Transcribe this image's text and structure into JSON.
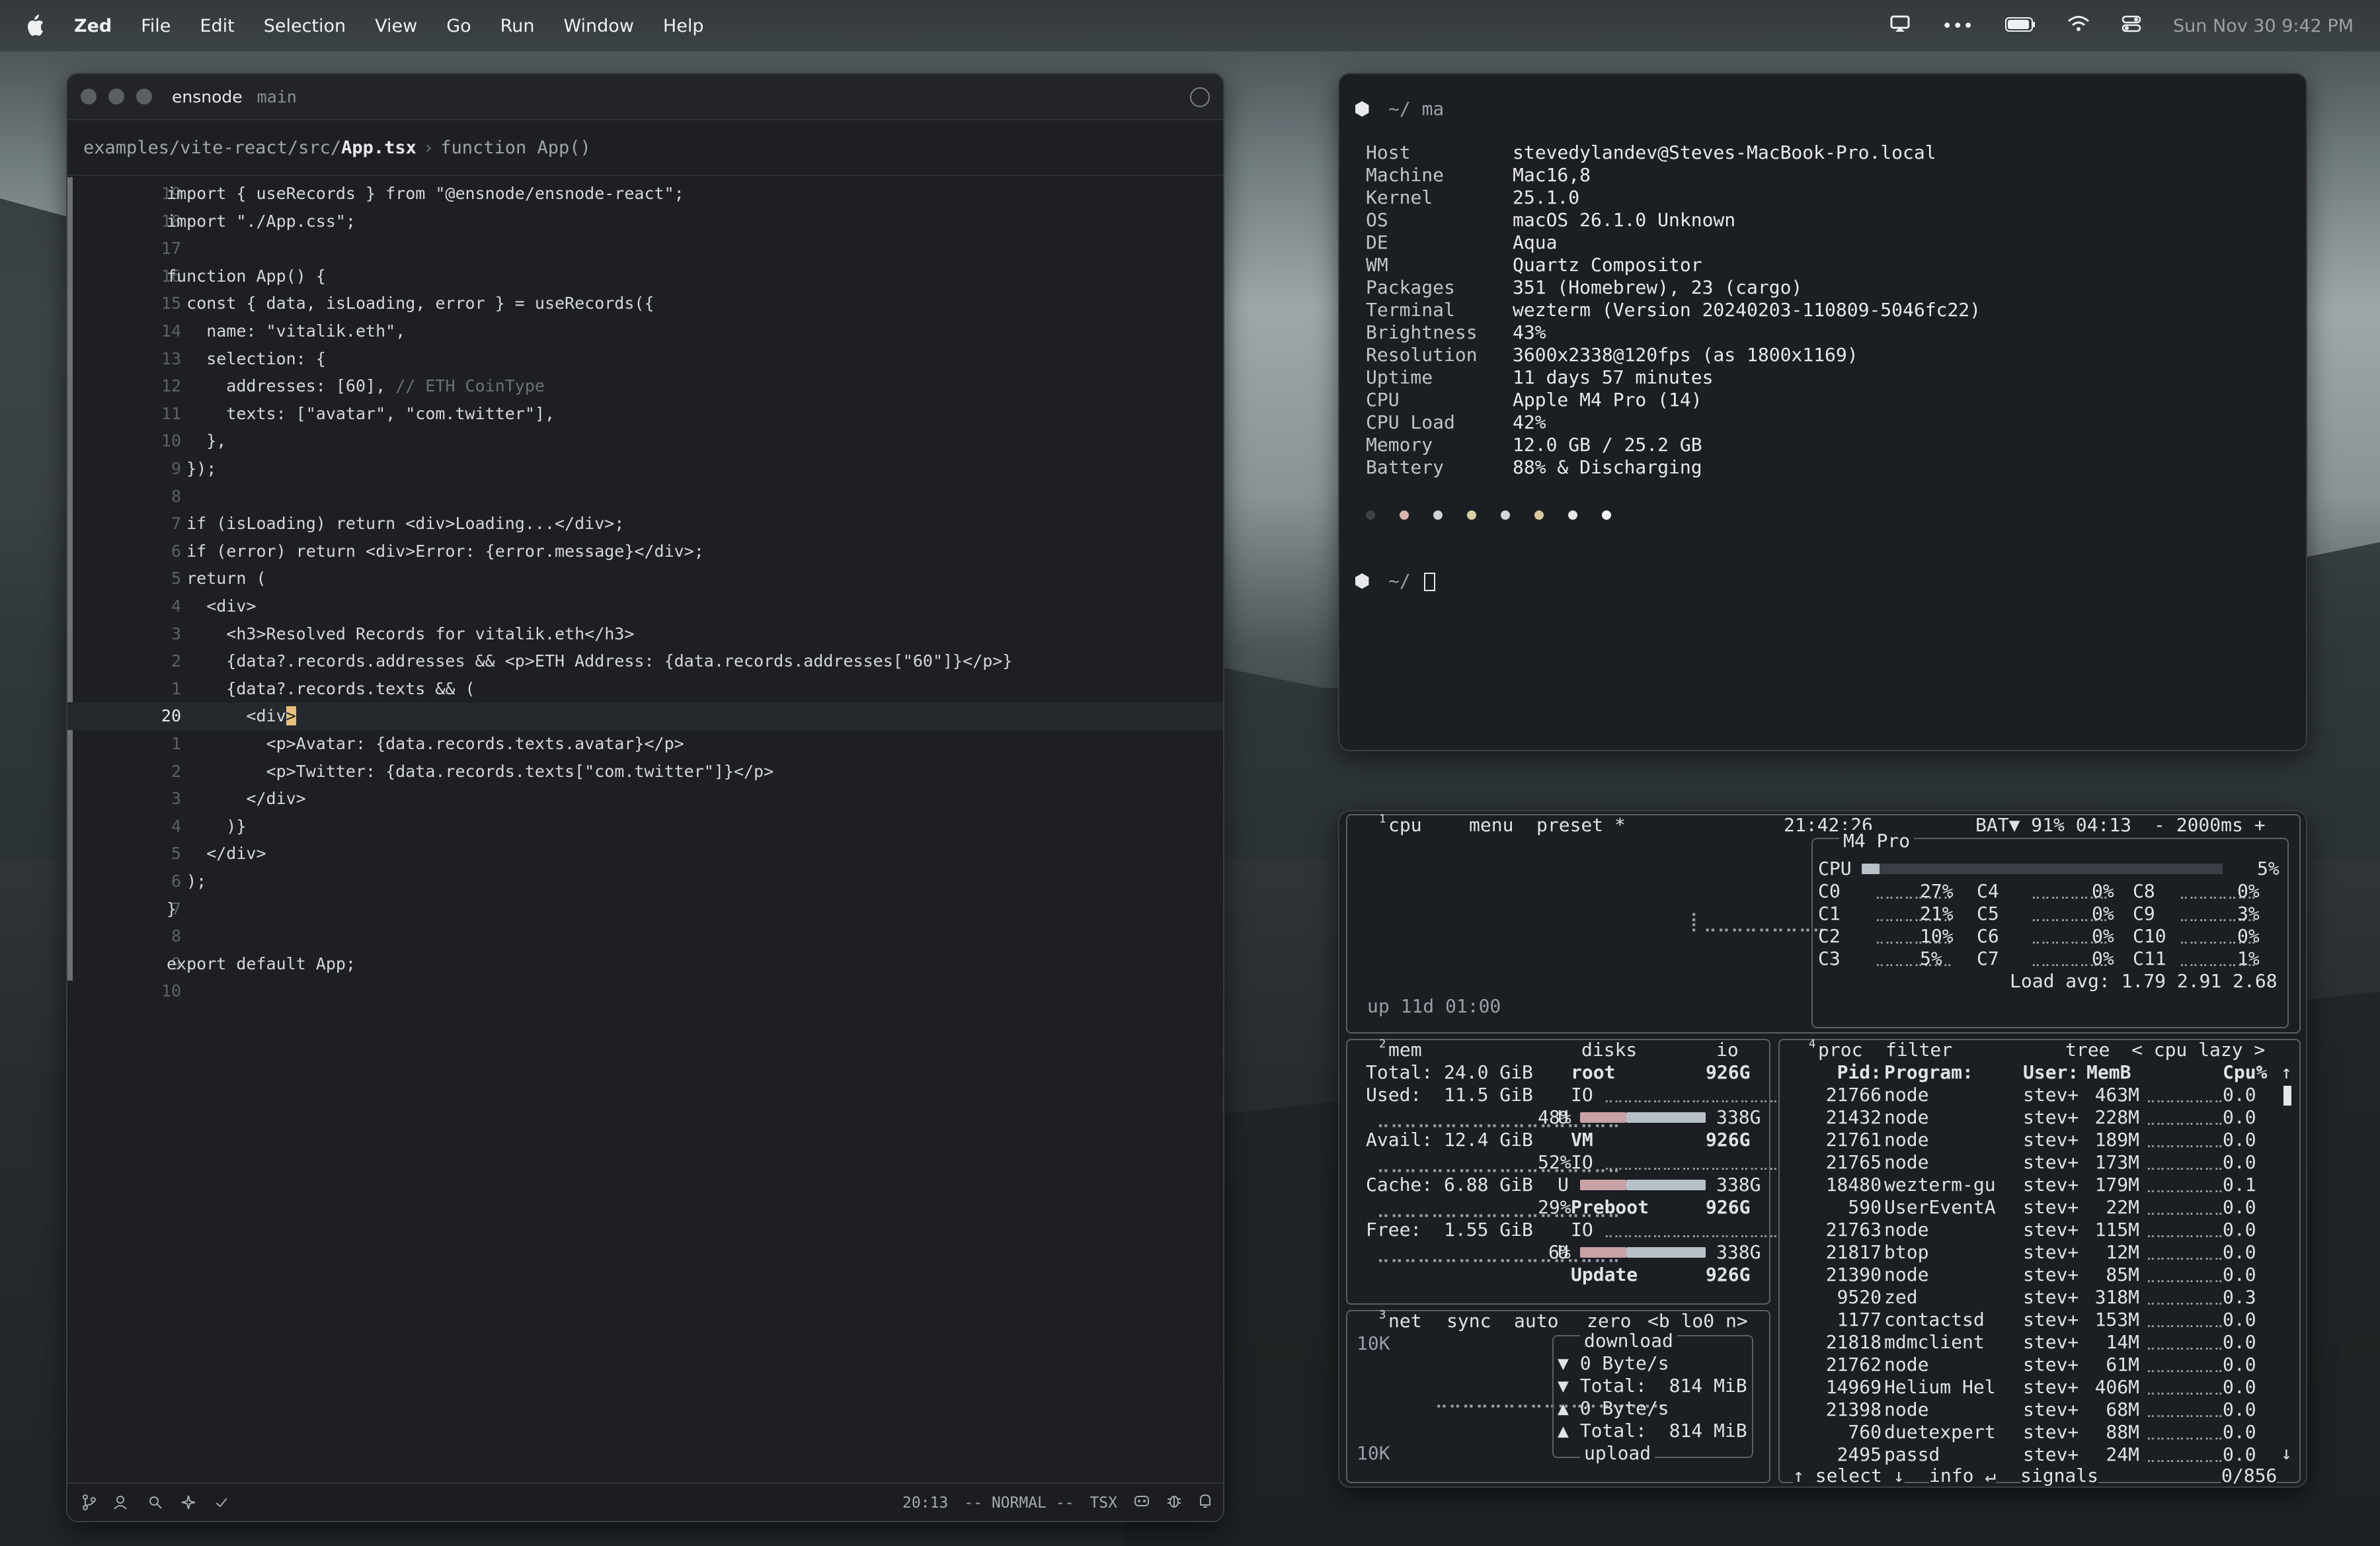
{
  "menubar": {
    "app": "Zed",
    "items": [
      "File",
      "Edit",
      "Selection",
      "View",
      "Go",
      "Run",
      "Window",
      "Help"
    ],
    "clock": "Sun Nov 30  9:42 PM"
  },
  "zed": {
    "project": "ensnode",
    "branch": "main",
    "breadcrumb": {
      "path": "examples/vite-react/src/",
      "file": "App.tsx",
      "separator": "›",
      "symbol": "function App()"
    },
    "lines": [
      {
        "n": "19",
        "t": "import { useRecords } from \"@ensnode/ensnode-react\";"
      },
      {
        "n": "18",
        "t": "import \"./App.css\";"
      },
      {
        "n": "17",
        "t": ""
      },
      {
        "n": "16",
        "t": "function App() {"
      },
      {
        "n": "15",
        "t": "  const { data, isLoading, error } = useRecords({"
      },
      {
        "n": "14",
        "t": "    name: \"vitalik.eth\","
      },
      {
        "n": "13",
        "t": "    selection: {"
      },
      {
        "n": "12",
        "t": "      addresses: [60], ",
        "c": "// ETH CoinType"
      },
      {
        "n": "11",
        "t": "      texts: [\"avatar\", \"com.twitter\"],"
      },
      {
        "n": "10",
        "t": "    },"
      },
      {
        "n": "9",
        "t": "  });"
      },
      {
        "n": "8",
        "t": ""
      },
      {
        "n": "7",
        "t": "  if (isLoading) return <div>Loading...</div>;"
      },
      {
        "n": "6",
        "t": "  if (error) return <div>Error: {error.message}</div>;"
      },
      {
        "n": "5",
        "t": "  return ("
      },
      {
        "n": "4",
        "t": "    <div>"
      },
      {
        "n": "3",
        "t": "      <h3>Resolved Records for vitalik.eth</h3>"
      },
      {
        "n": "2",
        "t": "      {data?.records.addresses && <p>ETH Address: {data.records.addresses[\"60\"]}</p>}"
      },
      {
        "n": "1",
        "t": "      {data?.records.texts && ("
      },
      {
        "n": "20",
        "t": "        <div",
        "cur": ">"
      },
      {
        "n": "1",
        "t": "          <p>Avatar: {data.records.texts.avatar}</p>"
      },
      {
        "n": "2",
        "t": "          <p>Twitter: {data.records.texts[\"com.twitter\"]}</p>"
      },
      {
        "n": "3",
        "t": "        </div>"
      },
      {
        "n": "4",
        "t": "      )}"
      },
      {
        "n": "5",
        "t": "    </div>"
      },
      {
        "n": "6",
        "t": "  );"
      },
      {
        "n": "7",
        "t": "}"
      },
      {
        "n": "8",
        "t": ""
      },
      {
        "n": "9",
        "t": "export default App;"
      },
      {
        "n": "10",
        "t": ""
      }
    ],
    "status": {
      "position": "20:13",
      "mode": "-- NORMAL --",
      "lang": "TSX"
    }
  },
  "terminal": {
    "prompt1": "~/ ma",
    "info": [
      [
        "Host",
        "stevedylandev@Steves-MacBook-Pro.local"
      ],
      [
        "Machine",
        "Mac16,8"
      ],
      [
        "Kernel",
        "25.1.0"
      ],
      [
        "OS",
        "macOS 26.1.0 Unknown"
      ],
      [
        "DE",
        "Aqua"
      ],
      [
        "WM",
        "Quartz Compositor"
      ],
      [
        "Packages",
        "351 (Homebrew), 23 (cargo)"
      ],
      [
        "Terminal",
        "wezterm (Version 20240203-110809-5046fc22)"
      ],
      [
        "Brightness",
        "43%"
      ],
      [
        "Resolution",
        "3600x2338@120fps (as 1800x1169)"
      ],
      [
        "Uptime",
        "11 days 57 minutes"
      ],
      [
        "CPU",
        "Apple M4 Pro (14)"
      ],
      [
        "CPU Load",
        "42%"
      ],
      [
        "Memory",
        "12.0 GB / 25.2 GB"
      ],
      [
        "Battery",
        "88% & Discharging"
      ]
    ],
    "dot_colors": [
      "#3d4247",
      "#d8b3b0",
      "#cfd3d6",
      "#d9cfa0",
      "#d4d6d8",
      "#d8c79a",
      "#e6e6e6",
      "#f2f2f2"
    ],
    "prompt2": "~/"
  },
  "btop": {
    "cpu_header": {
      "sup": "1",
      "title": "cpu",
      "menu": "menu",
      "preset": "preset *",
      "time": "21:42:26",
      "bat": "BAT▼ 91% 04:13",
      "rate": "- 2000ms +"
    },
    "cpu_box": {
      "title": "M4 Pro",
      "total_label": "CPU",
      "total": "5%",
      "total_pct": 5,
      "cores": [
        [
          "C0",
          "27%",
          "C4",
          "0%",
          "C8",
          "0%"
        ],
        [
          "C1",
          "21%",
          "C5",
          "0%",
          "C9",
          "3%"
        ],
        [
          "C2",
          "10%",
          "C6",
          "0%",
          "C10",
          "0%"
        ],
        [
          "C3",
          "5%",
          "C7",
          "0%",
          "C11",
          "1%"
        ]
      ],
      "load": "Load avg: 1.79 2.91 2.68"
    },
    "uptime": "up 11d 01:00",
    "mem": {
      "sup": "2",
      "title": "mem",
      "total": "Total: 24.0 GiB",
      "used": "Used:  11.5 GiB",
      "used_pct": "48%",
      "avail": "Avail: 12.4 GiB",
      "avail_pct": "52%",
      "cache": "Cache: 6.88 GiB",
      "cache_pct": "29%",
      "free": "Free:  1.55 GiB",
      "free_pct": "6%"
    },
    "disks": {
      "title": "disks",
      "io": "io",
      "items": [
        [
          "root",
          "926G",
          "IO",
          "U",
          "338G"
        ],
        [
          "VM",
          "926G",
          "IO",
          "U",
          "338G"
        ],
        [
          "Preboot",
          "926G",
          "IO",
          "U",
          "338G"
        ],
        [
          "Update",
          "926G"
        ]
      ]
    },
    "net": {
      "sup": "3",
      "title": "net",
      "sync": "sync",
      "auto": "auto",
      "zero": "zero",
      "iface": "<b lo0 n>",
      "scale_top": "10K",
      "scale_bot": "10K",
      "download": "download",
      "dl_rate": "▼ 0 Byte/s",
      "dl_total": "▼ Total:  814 MiB",
      "ul_rate": "▲ 0 Byte/s",
      "ul_total": "▲ Total:  814 MiB",
      "upload": "upload"
    },
    "proc": {
      "sup": "4",
      "title": "proc",
      "filter": "filter",
      "tree": "tree",
      "sort": "< cpu lazy >",
      "headers": [
        "Pid:",
        "Program:",
        "User:",
        "MemB",
        "Cpu%"
      ],
      "rows": [
        [
          "21766",
          "node",
          "stev+",
          "463M",
          "0.0"
        ],
        [
          "21432",
          "node",
          "stev+",
          "228M",
          "0.0"
        ],
        [
          "21761",
          "node",
          "stev+",
          "189M",
          "0.0"
        ],
        [
          "21765",
          "node",
          "stev+",
          "173M",
          "0.0"
        ],
        [
          "18480",
          "wezterm-gu",
          "stev+",
          "179M",
          "0.1"
        ],
        [
          "590",
          "UserEventA",
          "stev+",
          "22M",
          "0.0"
        ],
        [
          "21763",
          "node",
          "stev+",
          "115M",
          "0.0"
        ],
        [
          "21817",
          "btop",
          "stev+",
          "12M",
          "0.0"
        ],
        [
          "21390",
          "node",
          "stev+",
          "85M",
          "0.0"
        ],
        [
          "9520",
          "zed",
          "stev+",
          "318M",
          "0.3"
        ],
        [
          "1177",
          "contactsd",
          "stev+",
          "153M",
          "0.0"
        ],
        [
          "21818",
          "mdmclient",
          "stev+",
          "14M",
          "0.0"
        ],
        [
          "21762",
          "node",
          "stev+",
          "61M",
          "0.0"
        ],
        [
          "14969",
          "Helium Hel",
          "stev+",
          "406M",
          "0.0"
        ],
        [
          "21398",
          "node",
          "stev+",
          "68M",
          "0.0"
        ],
        [
          "760",
          "duetexpert",
          "stev+",
          "88M",
          "0.0"
        ],
        [
          "2495",
          "passd",
          "stev+",
          "24M",
          "0.0"
        ]
      ],
      "footer_select": "↑ select ↓",
      "footer_info": "info ↵",
      "footer_signals": "signals",
      "count": "0/856"
    }
  },
  "colors": {
    "accent": "#e8c07a",
    "bar_used": "#c9a2a5",
    "bar_mid": "#b8c0c8"
  }
}
